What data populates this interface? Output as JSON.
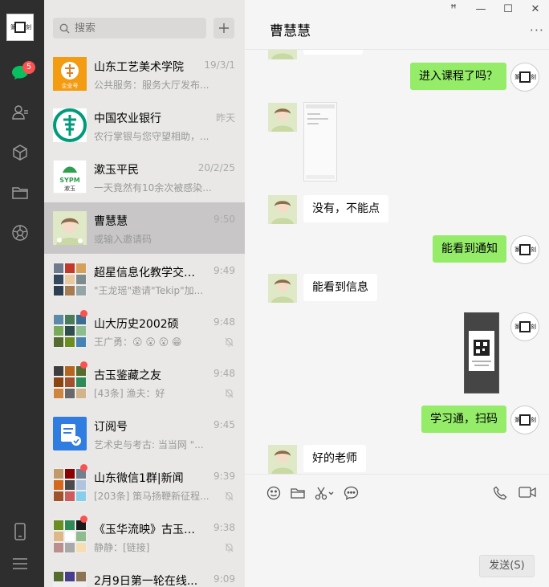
{
  "rail": {
    "unread_badge": "5"
  },
  "search": {
    "placeholder": "搜索"
  },
  "conversations": [
    {
      "name": "山东工艺美术学院",
      "time": "19/3/1",
      "preview": "公共服务：服务大厅发布..."
    },
    {
      "name": "中国农业银行",
      "time": "昨天",
      "preview": "农行掌银与您守望相助，..."
    },
    {
      "name": "漱玉平民",
      "time": "20/2/25",
      "preview": "一天竟然有10余次被感染..."
    },
    {
      "name": "曹慧慧",
      "time": "9:50",
      "preview": "或输入邀请码"
    },
    {
      "name": "超星信息化教学交流...",
      "time": "9:49",
      "preview": "\"王龙瑶\"邀请\"Tekip\"加..."
    },
    {
      "name": "山大历史2002硕",
      "time": "9:48",
      "preview": "王广勇：😮 😮 😮 😁"
    },
    {
      "name": "古玉鉴藏之友",
      "time": "9:48",
      "preview": "[43条] 渔夫：好"
    },
    {
      "name": "订阅号",
      "time": "9:45",
      "preview": "艺术史与考古: 当当网 \"..."
    },
    {
      "name": "山东微信1群|新闻",
      "time": "9:39",
      "preview": "[203条] 策马扬鞭新征程..."
    },
    {
      "name": "《玉华流映》古玉研...",
      "time": "9:38",
      "preview": "静静：[链接]"
    },
    {
      "name": "2月9日第一轮在线...",
      "time": "9:09",
      "preview": ""
    }
  ],
  "logo_texts": {
    "enterprise": "企业号",
    "sypm": "SYPM",
    "shuyu": "漱玉"
  },
  "window": {
    "pin": "ꟸ",
    "minimize": "—",
    "maximize": "☐",
    "close": "✕"
  },
  "chat": {
    "title": "曹慧慧",
    "more": "···",
    "messages": {
      "m1": "进入课程了吗？",
      "m2": "没有，不能点",
      "m3": "能看到通知",
      "m4": "能看到信息",
      "m5": "学习通，扫码",
      "m6": "好的老师"
    },
    "send_label": "发送(S)"
  },
  "colors": {
    "me_bubble": "#95ec69",
    "rail": "#2e2e2e",
    "list": "#e9e8e7",
    "active": "#c8c6c6",
    "badge": "#fa5151"
  }
}
